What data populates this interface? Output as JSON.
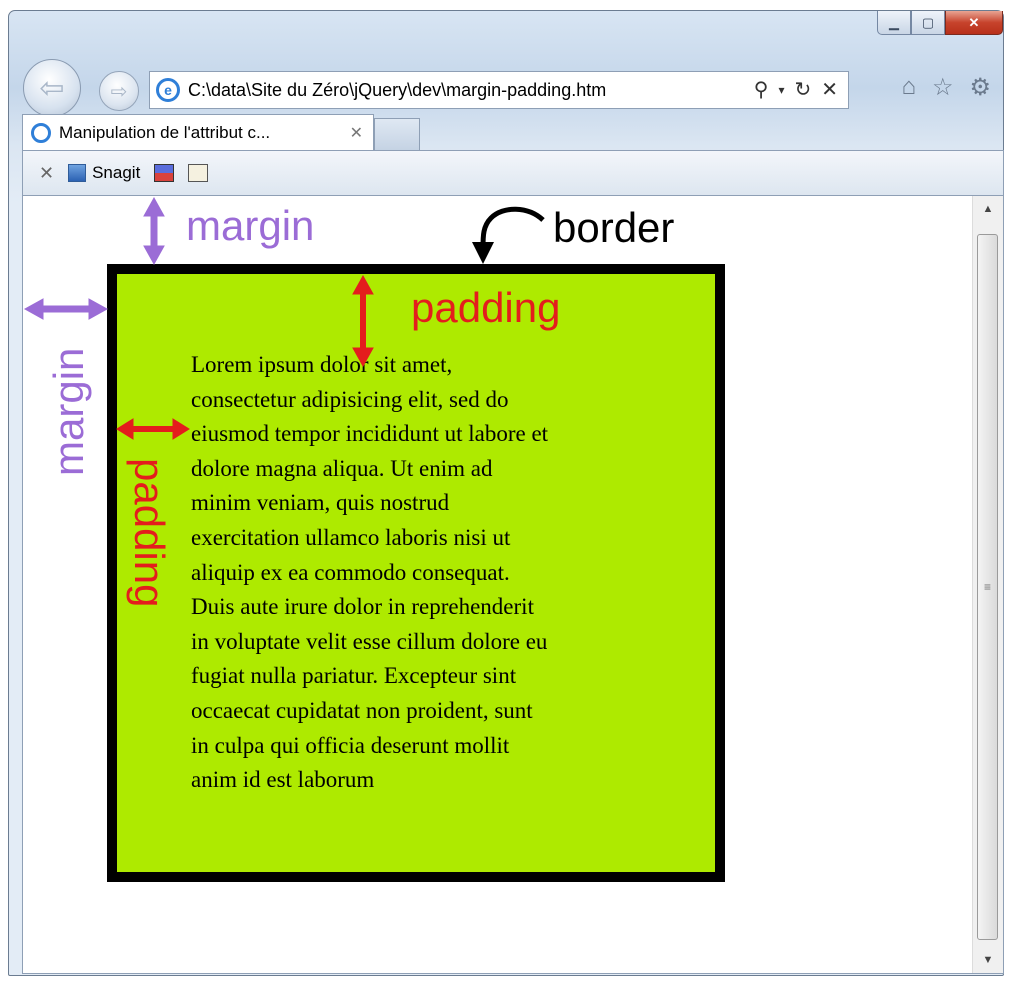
{
  "window": {
    "minimize_icon": "minimize-icon",
    "maximize_icon": "maximize-icon",
    "close_icon": "close-icon"
  },
  "nav": {
    "address": "C:\\data\\Site du Zéro\\jQuery\\dev\\margin-padding.htm",
    "search_icon": "search-icon",
    "dropdown_icon": "chevron-down-icon",
    "refresh_icon": "refresh-icon",
    "stop_icon": "close-icon",
    "home_icon": "home-icon",
    "favorites_icon": "star-icon",
    "tools_icon": "gear-icon"
  },
  "tabs": [
    {
      "label": "Manipulation de l'attribut c..."
    }
  ],
  "toolbar": {
    "close_icon": "close-icon",
    "snagit_label": "Snagit"
  },
  "page": {
    "lorem_lines": [
      "Lorem ipsum dolor sit amet,",
      "consectetur adipisicing elit, sed do",
      "eiusmod tempor incididunt ut labore et",
      "dolore magna aliqua. Ut enim ad",
      "minim veniam, quis nostrud",
      "exercitation ullamco laboris nisi ut",
      "aliquip ex ea commodo consequat.",
      "Duis aute irure dolor in reprehenderit",
      "in voluptate velit esse cillum dolore eu",
      "fugiat nulla pariatur. Excepteur sint",
      "occaecat cupidatat non proident, sunt",
      "in culpa qui officia deserunt mollit",
      "anim id est laborum"
    ],
    "box_color": "#aeea00",
    "border_color": "#000000"
  },
  "annotations": {
    "margin_top": "margin",
    "margin_left": "margin",
    "border": "border",
    "padding_top": "padding",
    "padding_left": "padding",
    "margin_color": "#9b6cd6",
    "padding_color": "#e41d1d"
  }
}
